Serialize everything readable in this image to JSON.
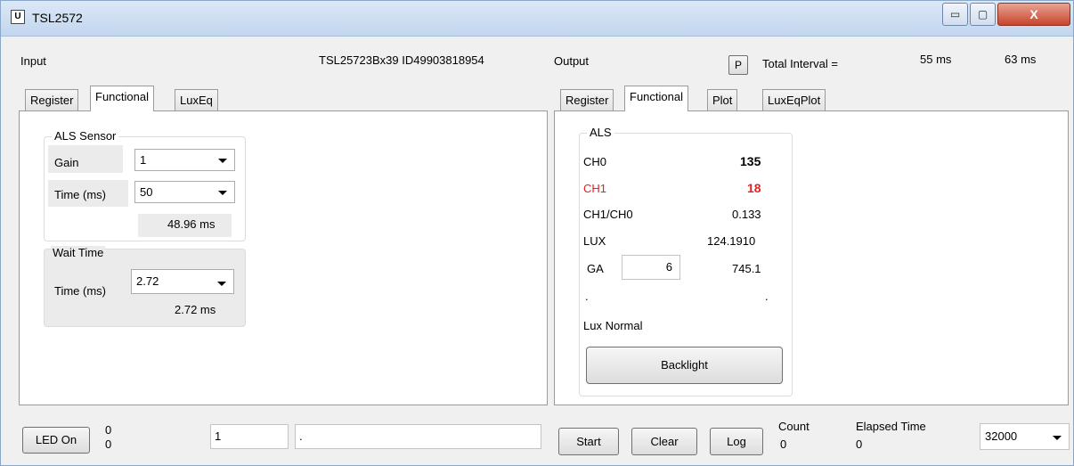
{
  "window": {
    "title": "TSL2572",
    "app_icon": "U",
    "controls": {
      "minimize": "▭",
      "maximize": "▢",
      "close": "X"
    }
  },
  "header": {
    "input_label": "Input",
    "device_id": "TSL25723Bx39 ID49903818954",
    "output_label": "Output",
    "p_button": "P",
    "total_interval_label": "Total Interval =",
    "interval_1": "55 ms",
    "interval_2": "63 ms"
  },
  "left_tabs": [
    "Register",
    "Functional",
    "LuxEq"
  ],
  "als_sensor": {
    "title": "ALS Sensor",
    "gain_label": "Gain",
    "gain_value": "1",
    "time_label": "Time (ms)",
    "time_value": "50",
    "time_readout": "48.96 ms"
  },
  "wait_time": {
    "title": "Wait Time",
    "time_label": "Time (ms)",
    "time_value": "2.72",
    "time_readout": "2.72 ms"
  },
  "right_tabs": [
    "Register",
    "Functional",
    "Plot",
    "LuxEqPlot"
  ],
  "als": {
    "title": "ALS",
    "ch0_label": "CH0",
    "ch0_value": "135",
    "ch1_label": "CH1",
    "ch1_value": "18",
    "ratio_label": "CH1/CH0",
    "ratio_value": "0.133",
    "lux_label": "LUX",
    "lux_value": "124.1910",
    "ga_label": "GA",
    "ga_input": "6",
    "ga_value": "745.1",
    "dot_left": ".",
    "dot_right": ".",
    "status": "Lux Normal",
    "backlight_button": "Backlight"
  },
  "footer_left": {
    "led_button": "LED On",
    "count_1": "0",
    "count_2": "0",
    "input_1": "1",
    "input_2": "."
  },
  "footer_right": {
    "start_button": "Start",
    "clear_button": "Clear",
    "log_button": "Log",
    "count_label": "Count",
    "count_value": "0",
    "elapsed_label": "Elapsed Time",
    "elapsed_value": "0",
    "rate_value": "32000"
  },
  "colors": {
    "accent_red": "#e81e1e",
    "titlebar": "#c2d6ee",
    "close_button": "#c7442d"
  }
}
